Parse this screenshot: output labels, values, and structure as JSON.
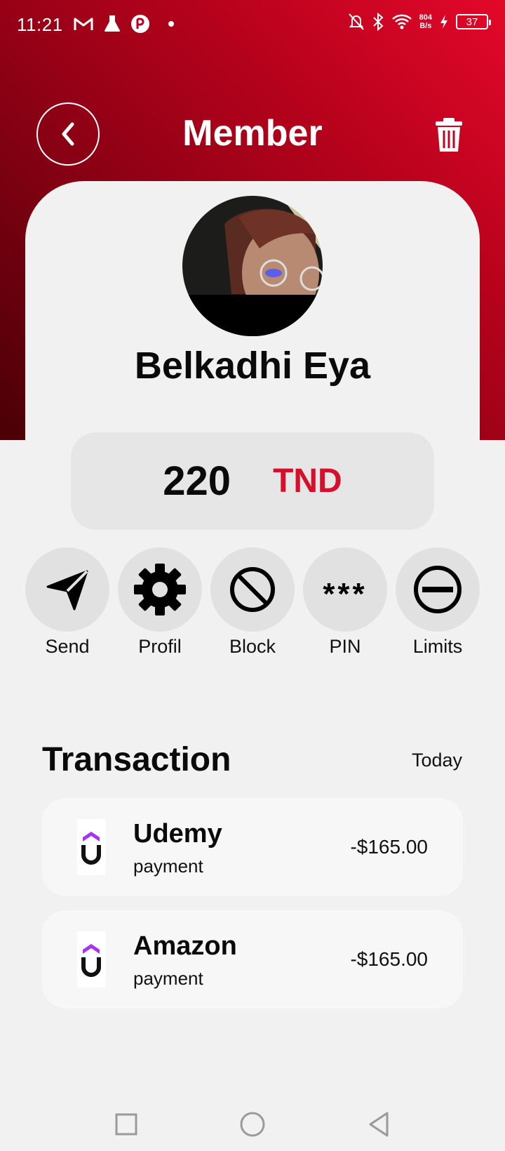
{
  "status_bar": {
    "time": "11:21",
    "net_speed_top": "804",
    "net_speed_bottom": "B/s",
    "battery": "37",
    "left_icons": [
      "gmail-icon",
      "lab-flask-icon",
      "app-notification-icon",
      "dot-icon"
    ],
    "right_icons": [
      "mute-bell-icon",
      "bluetooth-icon",
      "wifi-icon",
      "charging-icon",
      "battery-icon"
    ]
  },
  "header": {
    "title": "Member",
    "back_icon": "chevron-left-icon",
    "delete_icon": "trash-icon"
  },
  "profile": {
    "name": "Belkadhi Eya"
  },
  "balance": {
    "amount": "220",
    "currency": "TND"
  },
  "actions": [
    {
      "label": "Send",
      "icon": "send-icon"
    },
    {
      "label": "Profil",
      "icon": "gear-icon"
    },
    {
      "label": "Block",
      "icon": "block-icon"
    },
    {
      "label": "PIN",
      "icon": "asterisks-icon",
      "glyph": "***"
    },
    {
      "label": "Limits",
      "icon": "minus-circle-icon"
    }
  ],
  "transactions": {
    "title": "Transaction",
    "filter": "Today",
    "items": [
      {
        "name": "Udemy",
        "type": "payment",
        "amount": "-$165.00",
        "icon": "udemy-logo-icon"
      },
      {
        "name": "Amazon",
        "type": "payment",
        "amount": "-$165.00",
        "icon": "udemy-logo-icon"
      }
    ]
  },
  "nav": [
    "recents-square-icon",
    "home-circle-icon",
    "back-triangle-icon"
  ],
  "colors": {
    "accent": "#d4102b",
    "header_gradient": [
      "#e3082a",
      "#4a0006"
    ],
    "background": "#f1f1f1"
  }
}
